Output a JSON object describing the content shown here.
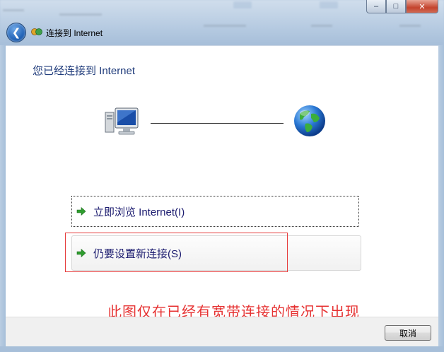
{
  "window": {
    "breadcrumb": "连接到 Internet",
    "buttons": {
      "minimize": "–",
      "maximize": "□",
      "close": "✕"
    },
    "back_icon": "back-arrow-icon",
    "crumb_icon": "network-icon"
  },
  "content": {
    "heading": "您已经连接到 Internet",
    "icons": [
      "computer-icon",
      "globe-icon"
    ],
    "options": [
      {
        "label": "立即浏览 Internet(I)",
        "icon": "green-arrow-icon"
      },
      {
        "label": "仍要设置新连接(S)",
        "icon": "green-arrow-icon"
      }
    ],
    "annotation": "此图仅在已经有宽带连接的情况下出现"
  },
  "footer": {
    "cancel_label": "取消"
  },
  "colors": {
    "heading": "#1e3a7a",
    "link": "#1b1b6f",
    "annotation": "#e63232",
    "highlight_box": "#e63c3c"
  }
}
